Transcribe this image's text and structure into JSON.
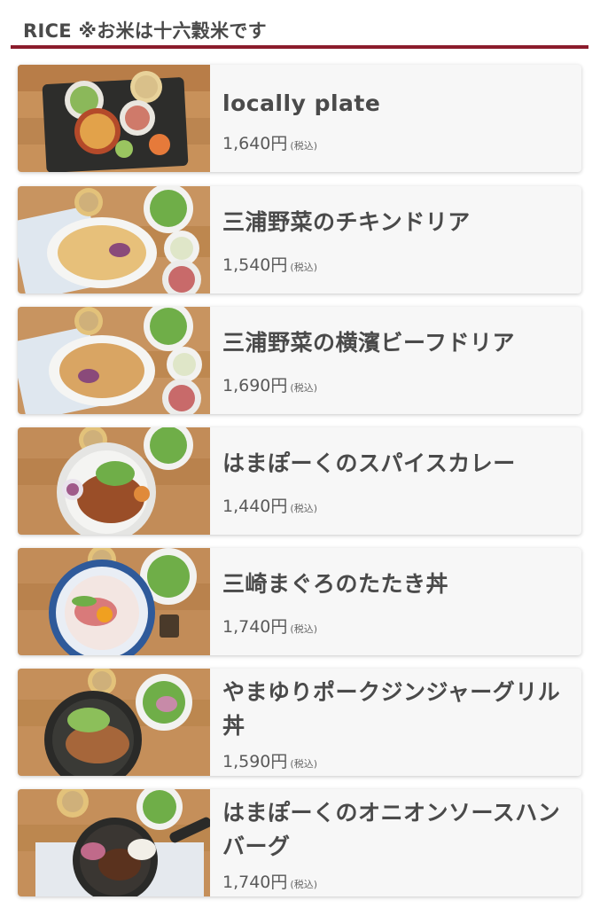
{
  "section": {
    "title": "RICE ※お米は十六穀米です"
  },
  "colors": {
    "accent": "#8b1c2c",
    "card_bg": "#f7f7f7",
    "text": "#4a4a4a"
  },
  "menu": [
    {
      "name": "locally plate",
      "price": "1,640円",
      "tax": "(税込)",
      "image": "locally-plate-photo"
    },
    {
      "name": "三浦野菜のチキンドリア",
      "price": "1,540円",
      "tax": "(税込)",
      "image": "chicken-doria-photo"
    },
    {
      "name": "三浦野菜の横濱ビーフドリア",
      "price": "1,690円",
      "tax": "(税込)",
      "image": "beef-doria-photo"
    },
    {
      "name": "はまぽーくのスパイスカレー",
      "price": "1,440円",
      "tax": "(税込)",
      "image": "spice-curry-photo"
    },
    {
      "name": "三崎まぐろのたたき丼",
      "price": "1,740円",
      "tax": "(税込)",
      "image": "tuna-tataki-bowl-photo"
    },
    {
      "name": "やまゆりポークジンジャーグリル丼",
      "price": "1,590円",
      "tax": "(税込)",
      "image": "pork-ginger-bowl-photo"
    },
    {
      "name": "はまぽーくのオニオンソースハンバーグ",
      "price": "1,740円",
      "tax": "(税込)",
      "image": "hamburg-steak-photo"
    }
  ]
}
